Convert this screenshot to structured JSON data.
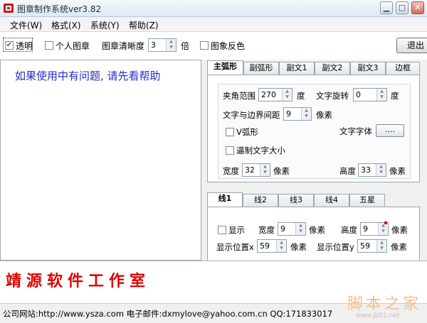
{
  "window": {
    "title": "图章制作系统ver3.82",
    "min_icon": "minimize-icon",
    "max_icon": "maximize-icon",
    "close_icon": "close-icon"
  },
  "menu": [
    "文件(W)",
    "格式(X)",
    "系统(Y)",
    "帮助(Z)"
  ],
  "toolbar": {
    "transparent_label": "透明",
    "transparent_checked": true,
    "personal_label": "个人图章",
    "personal_checked": false,
    "clarity_label": "图章清晰度",
    "clarity_value": "3",
    "clarity_unit": "倍",
    "invert_label": "图象反色",
    "invert_checked": false,
    "exit_label": "退出"
  },
  "help_text": "如果使用中有问题, 请先看帮助",
  "top_tabs": [
    "主弧形",
    "副弧形",
    "副文1",
    "副文2",
    "副文3",
    "边框"
  ],
  "arc_panel": {
    "angle_label": "夹角范围",
    "angle_value": "270",
    "angle_unit": "度",
    "rotate_label": "文字旋转",
    "rotate_value": "0",
    "rotate_unit": "度",
    "margin_label": "文字与边界间距",
    "margin_value": "9",
    "margin_unit": "像素",
    "vshape_label": "V弧形",
    "vshape_checked": false,
    "font_label": "文字字体",
    "font_button": "....",
    "force_label": "逼制文字大小",
    "force_checked": false,
    "width_label": "宽度",
    "width_value": "32",
    "width_unit": "像素",
    "height_label": "高度",
    "height_value": "33",
    "height_unit": "像素"
  },
  "bottom_tabs": [
    "线1",
    "线2",
    "线3",
    "线4",
    "五星"
  ],
  "line_panel": {
    "show_label": "显示",
    "show_checked": false,
    "width_label": "宽度",
    "width_value": "9",
    "width_unit": "像素",
    "height_label": "高度",
    "height_value": "9",
    "height_unit": "像素",
    "posx_label": "显示位置x",
    "posx_value": "59",
    "posx_unit": "像素",
    "posy_label": "显示位置y",
    "posy_value": "59",
    "posy_unit": "像素"
  },
  "brand": "靖源软件工作室",
  "status": "公司网站:http://www.ysza.com 电子邮件:dxmylove@yahoo.com.cn QQ:171833017",
  "watermark": {
    "big": "脚本之家",
    "small": "www.jb51.net"
  }
}
